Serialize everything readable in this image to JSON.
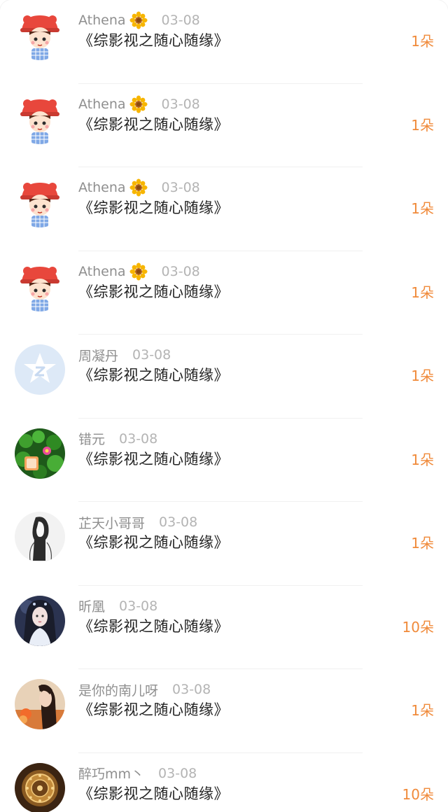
{
  "rows": [
    {
      "name": "Athena",
      "flower": true,
      "date": "03-08",
      "book": "《综影视之随心随缘》",
      "gift": "1朵",
      "avatar_icon": "cartoon-girl-avatar"
    },
    {
      "name": "Athena",
      "flower": true,
      "date": "03-08",
      "book": "《综影视之随心随缘》",
      "gift": "1朵",
      "avatar_icon": "cartoon-girl-avatar"
    },
    {
      "name": "Athena",
      "flower": true,
      "date": "03-08",
      "book": "《综影视之随心随缘》",
      "gift": "1朵",
      "avatar_icon": "cartoon-girl-avatar"
    },
    {
      "name": "Athena",
      "flower": true,
      "date": "03-08",
      "book": "《综影视之随心随缘》",
      "gift": "1朵",
      "avatar_icon": "cartoon-girl-avatar"
    },
    {
      "name": "周凝丹",
      "flower": false,
      "date": "03-08",
      "book": "《综影视之随心随缘》",
      "gift": "1朵",
      "avatar_icon": "default-star-avatar"
    },
    {
      "name": "错元",
      "flower": false,
      "date": "03-08",
      "book": "《综影视之随心随缘》",
      "gift": "1朵",
      "avatar_icon": "clover-flower-avatar"
    },
    {
      "name": "芷天小哥哥",
      "flower": false,
      "date": "03-08",
      "book": "《综影视之随心随缘》",
      "gift": "1朵",
      "avatar_icon": "sketch-figure-avatar"
    },
    {
      "name": "昕凰",
      "flower": false,
      "date": "03-08",
      "book": "《综影视之随心随缘》",
      "gift": "10朵",
      "avatar_icon": "costume-woman-avatar"
    },
    {
      "name": "是你的南儿呀",
      "flower": false,
      "date": "03-08",
      "book": "《综影视之随心随缘》",
      "gift": "1朵",
      "avatar_icon": "photo-girl-avatar"
    },
    {
      "name": "醉巧mm丶",
      "flower": false,
      "date": "03-08",
      "book": "《综影视之随心随缘》",
      "gift": "10朵",
      "avatar_icon": "golden-pattern-avatar"
    }
  ],
  "colors": {
    "gift": "#f08a3a",
    "name": "#8f8f8f",
    "date": "#b4b4b4",
    "book": "#222222",
    "divider": "#f0f0f0"
  }
}
